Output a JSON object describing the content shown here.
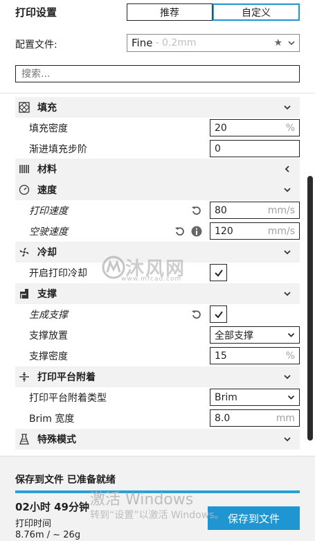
{
  "header": {
    "title": "打印设置",
    "tabs": [
      {
        "label": "推荐",
        "active": false
      },
      {
        "label": "自定义",
        "active": true
      }
    ]
  },
  "profile": {
    "label": "配置文件:",
    "value": "Fine",
    "sub": "- 0.2mm"
  },
  "search": {
    "placeholder": "搜索..."
  },
  "sections": {
    "infill": {
      "label": "填充",
      "density": {
        "label": "填充密度",
        "value": "20",
        "unit": "%"
      },
      "gradual": {
        "label": "渐进填充步阶",
        "value": "0"
      }
    },
    "material": {
      "label": "材料"
    },
    "speed": {
      "label": "速度",
      "print_speed": {
        "label": "打印速度",
        "value": "80",
        "unit": "mm/s"
      },
      "travel_speed": {
        "label": "空驶速度",
        "value": "120",
        "unit": "mm/s"
      }
    },
    "cooling": {
      "label": "冷却",
      "enable": {
        "label": "开启打印冷却",
        "checked": true
      }
    },
    "support": {
      "label": "支撑",
      "generate": {
        "label": "生成支撑",
        "checked": true
      },
      "placement": {
        "label": "支撑放置",
        "value": "全部支撑"
      },
      "density": {
        "label": "支撑密度",
        "value": "15",
        "unit": "%"
      }
    },
    "adhesion": {
      "label": "打印平台附着",
      "type": {
        "label": "打印平台附着类型",
        "value": "Brim"
      },
      "brim_width": {
        "label": "Brim 宽度",
        "value": "8.0",
        "unit": "mm"
      }
    },
    "special": {
      "label": "特殊模式"
    }
  },
  "footer": {
    "status": "保存到文件 已准备就绪",
    "progress": 1.0,
    "time": "02小时 49分钟",
    "time_label": "打印时间",
    "material": "8.76m / ~ 26g",
    "save_button": "保存到文件"
  },
  "watermark": {
    "text": "沐风网",
    "url": "www.mfcad.com"
  },
  "os_notice": {
    "title": "激活 Windows",
    "sub": "转到“设置”以激活 Windows。"
  },
  "colors": {
    "accent": "#1f96d2",
    "category_bg": "#f2f2f2"
  }
}
